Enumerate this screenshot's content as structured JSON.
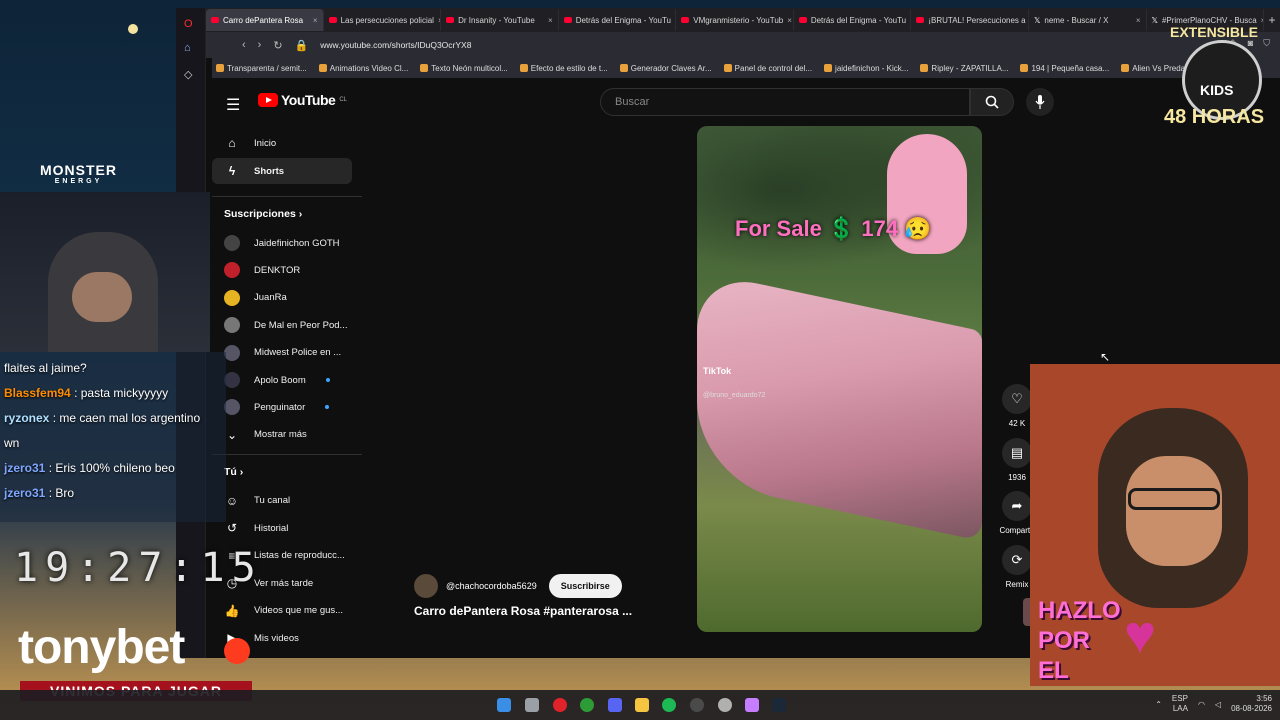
{
  "browser": {
    "tabs": [
      {
        "label": "Carro dePantera Rosa",
        "active": true,
        "icon": "youtube-icon"
      },
      {
        "label": "Las persecuciones policial",
        "icon": "youtube-icon"
      },
      {
        "label": "Dr Insanity - YouTube",
        "icon": "youtube-icon"
      },
      {
        "label": "Detrás del Enigma - YouTu",
        "icon": "youtube-icon"
      },
      {
        "label": "VMgranmisterio - YouTub",
        "icon": "youtube-icon"
      },
      {
        "label": "Detrás del Enigma - YouTu",
        "icon": "youtube-icon"
      },
      {
        "label": "¡BRUTAL! Persecuciones a",
        "icon": "youtube-icon"
      },
      {
        "label": "neme - Buscar / X",
        "icon": "x-icon"
      },
      {
        "label": "#PrimerPlanoCHV - Busca",
        "icon": "x-icon"
      }
    ],
    "url": "www.youtube.com/shorts/IDuQ3OcrYX8",
    "bookmarks": [
      "Transparenta / semit...",
      "Animations Video Cl...",
      "Texto Neón multicol...",
      "Efecto de estilo de t...",
      "Generador Claves Ar...",
      "Panel de control del...",
      "jaidefinichon - Kick...",
      "Ripley - ZAPATILLA...",
      "194 | Pequeña casa...",
      "Alien Vs Predator-alf..."
    ]
  },
  "youtube": {
    "logo_text": "YouTube",
    "logo_region": "CL",
    "search_placeholder": "Buscar",
    "guide": {
      "main": [
        {
          "label": "Inicio",
          "icon": "home-icon"
        },
        {
          "label": "Shorts",
          "icon": "shorts-icon",
          "active": true
        }
      ],
      "subscriptions_title": "Suscripciones",
      "subscriptions": [
        {
          "label": "Jaidefinichon GOTH"
        },
        {
          "label": "DENKTOR"
        },
        {
          "label": "JuanRa"
        },
        {
          "label": "De Mal en Peor Pod..."
        },
        {
          "label": "Midwest Police en ..."
        },
        {
          "label": "Apolo Boom",
          "new": true
        },
        {
          "label": "Penguinator",
          "new": true
        }
      ],
      "show_more": "Mostrar más",
      "you_title": "Tú",
      "you": [
        {
          "label": "Tu canal",
          "icon": "channel-icon"
        },
        {
          "label": "Historial",
          "icon": "history-icon"
        },
        {
          "label": "Listas de reproducc...",
          "icon": "playlist-icon"
        },
        {
          "label": "Ver más tarde",
          "icon": "clock-icon"
        },
        {
          "label": "Videos que me gus...",
          "icon": "like-icon"
        },
        {
          "label": "Mis videos",
          "icon": "video-icon"
        }
      ]
    },
    "short": {
      "overlay_text": "For Sale 💲 174 😥",
      "tiktok_label": "TikTok",
      "tiktok_user": "@bruno_eduardo72",
      "channel": "@chachocordoba5629",
      "subscribe": "Suscribirse",
      "title": "Carro dePantera Rosa #panterarosa ..."
    },
    "actions": [
      {
        "label": "42 K",
        "icon": "like-icon"
      },
      {
        "label": "1936",
        "icon": "comment-icon"
      },
      {
        "label": "Compartir",
        "icon": "share-icon"
      },
      {
        "label": "Remix",
        "icon": "remix-icon"
      }
    ]
  },
  "stream": {
    "chat": [
      {
        "user": "",
        "text": "flaites al jaime?",
        "user_color": "#ffffff"
      },
      {
        "user": "Blassfem94",
        "text": ": pasta mickyyyyy",
        "user_color": "#ff8c00"
      },
      {
        "user": "ryzonex",
        "text": ": me caen mal los argentino",
        "user_color": "#b0e0ff"
      },
      {
        "user": "",
        "text": "wn",
        "user_color": "#ffffff"
      },
      {
        "user": "jzero31",
        "text": ": Eris 100% chileno beo",
        "user_color": "#7fa7ff"
      },
      {
        "user": "jzero31",
        "text": ": Bro",
        "user_color": "#7fa7ff"
      }
    ],
    "clock": "19:27:15",
    "monster": "MONSTER",
    "monster_sub": "ENERGY",
    "sponsor": "tonybet",
    "sponsor_slogan": "VINIMOS PARA JUGAR",
    "badge_top": "EXTENSIBLE",
    "badge_kids": "KIDS",
    "badge_hours": "48 HORAS",
    "hazlo": [
      "HAZLO",
      "POR",
      "EL"
    ]
  },
  "taskbar": {
    "lang": "ESP",
    "lang_sub": "LAA",
    "time": "3:56",
    "date": "08-08-2026"
  },
  "colors": {
    "yt_red": "#ff0000",
    "bg_dark": "#0f0f0f",
    "accent_pink": "#ff6fc0"
  }
}
